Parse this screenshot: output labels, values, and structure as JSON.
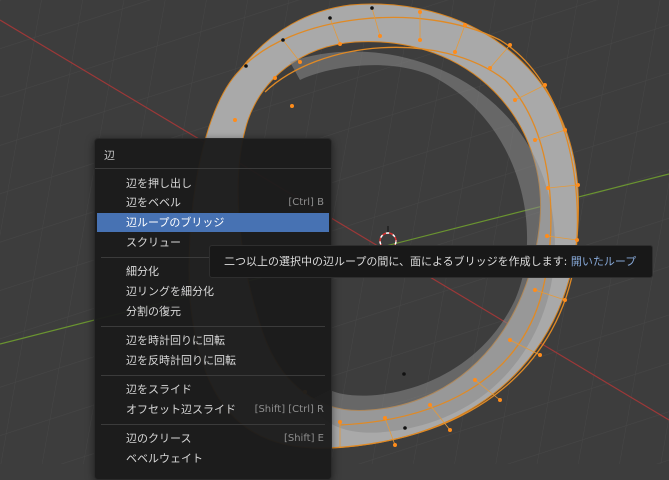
{
  "menu": {
    "title": "辺",
    "items": [
      {
        "label": "辺を押し出し",
        "shortcut": ""
      },
      {
        "label": "辺をベベル",
        "shortcut": "[Ctrl] B"
      },
      {
        "label": "辺ループのブリッジ",
        "shortcut": "",
        "active": true
      },
      {
        "label": "スクリュー",
        "shortcut": ""
      },
      {
        "label": "細分化",
        "shortcut": ""
      },
      {
        "label": "辺リングを細分化",
        "shortcut": ""
      },
      {
        "label": "分割の復元",
        "shortcut": ""
      },
      {
        "label": "辺を時計回りに回転",
        "shortcut": ""
      },
      {
        "label": "辺を反時計回りに回転",
        "shortcut": ""
      },
      {
        "label": "辺をスライド",
        "shortcut": ""
      },
      {
        "label": "オフセット辺スライド",
        "shortcut": "[Shift] [Ctrl] R"
      },
      {
        "label": "辺のクリース",
        "shortcut": "[Shift] E"
      },
      {
        "label": "ベベルウェイト",
        "shortcut": ""
      }
    ]
  },
  "tooltip": {
    "description": "二つ以上の選択中の辺ループの間に、面によるブリッジを作成します:",
    "value": "開いたループ"
  },
  "colors": {
    "viewport_bg": "#3d3d3d",
    "highlight": "#4772b3",
    "selected_vertex": "#ff8c1a",
    "x_axis": "#b03a3a",
    "y_axis": "#6f9a2c"
  }
}
